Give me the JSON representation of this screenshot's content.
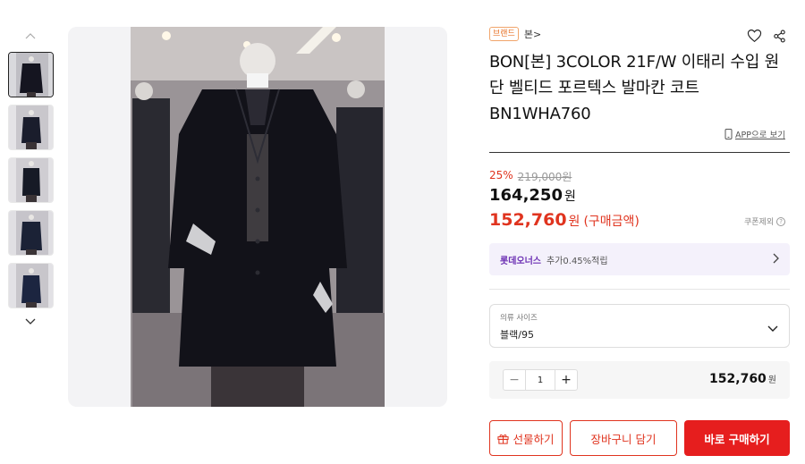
{
  "gallery": {
    "thumbnails": [
      "thumb-1",
      "thumb-2",
      "thumb-3",
      "thumb-4",
      "thumb-5"
    ],
    "active_index": 0,
    "up_icon": "chevron-up-icon",
    "down_icon": "chevron-down-icon"
  },
  "product": {
    "brand_badge": "브랜드",
    "brand_name": "본>",
    "title": "BON[본] 3COLOR 21F/W 이태리 수입 원단 벨티드 포르텍스 발마칸 코트 BN1WHA760",
    "app_link": "APP으로 보기"
  },
  "price": {
    "discount_rate": "25%",
    "original_price": "219,000원",
    "sale_price": "164,250",
    "sale_unit": "원",
    "final_price": "152,760",
    "final_unit": "원",
    "final_note": "(구매금액)",
    "coupon_label": "쿠폰제외",
    "accent_color": "#e0341f"
  },
  "lotte": {
    "name": "롯데오너스",
    "desc": "추가0.45%적립"
  },
  "option": {
    "label": "의류 사이즈",
    "value": "블랙/95"
  },
  "quantity": {
    "minus": "−",
    "value": "1",
    "plus": "+",
    "total": "152,760",
    "unit": "원"
  },
  "actions": {
    "gift_label": "선물하기",
    "cart_label": "장바구니 담기",
    "buy_label": "바로 구매하기"
  }
}
